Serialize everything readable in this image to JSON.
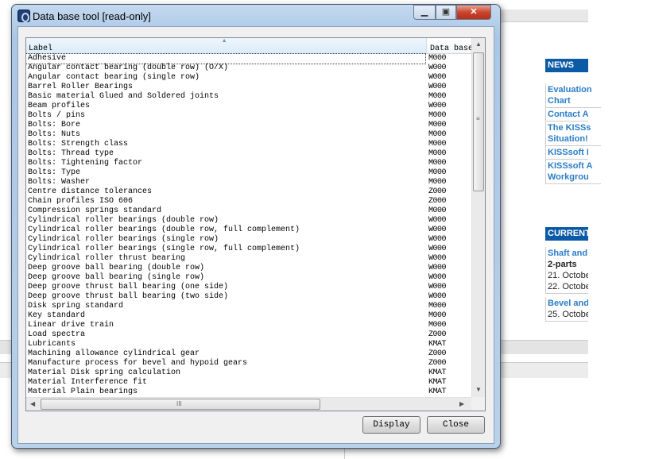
{
  "dialog": {
    "title": "Data base tool [read-only]",
    "minimize_icon": "minimize-icon",
    "maximize_icon": "maximize-icon",
    "close_icon": "close-x-icon"
  },
  "table": {
    "columns": [
      "Label",
      "Data base"
    ],
    "sort_indicator": "ascending",
    "rows": [
      {
        "label": "Adhesive",
        "db": "M000"
      },
      {
        "label": "Angular contact bearing (double row) (O/X)",
        "db": "W000"
      },
      {
        "label": "Angular contact bearing (single row)",
        "db": "W000"
      },
      {
        "label": "Barrel Roller Bearings",
        "db": "W000"
      },
      {
        "label": "Basic material Glued and Soldered joints",
        "db": "M000"
      },
      {
        "label": "Beam profiles",
        "db": "W000"
      },
      {
        "label": "Bolts / pins",
        "db": "M000"
      },
      {
        "label": "Bolts: Bore",
        "db": "M000"
      },
      {
        "label": "Bolts: Nuts",
        "db": "M000"
      },
      {
        "label": "Bolts: Strength class",
        "db": "M000"
      },
      {
        "label": "Bolts: Thread type",
        "db": "M000"
      },
      {
        "label": "Bolts: Tightening factor",
        "db": "M000"
      },
      {
        "label": "Bolts: Type",
        "db": "M000"
      },
      {
        "label": "Bolts: Washer",
        "db": "M000"
      },
      {
        "label": "Centre distance tolerances",
        "db": "Z000"
      },
      {
        "label": "Chain profiles ISO 606",
        "db": "Z000"
      },
      {
        "label": "Compression springs standard",
        "db": "M000"
      },
      {
        "label": "Cylindrical roller bearings (double row)",
        "db": "W000"
      },
      {
        "label": "Cylindrical roller bearings (double row, full complement)",
        "db": "W000"
      },
      {
        "label": "Cylindrical roller bearings (single row)",
        "db": "W000"
      },
      {
        "label": "Cylindrical roller bearings (single row, full complement)",
        "db": "W000"
      },
      {
        "label": "Cylindrical roller thrust bearing",
        "db": "W000"
      },
      {
        "label": "Deep groove ball bearing (double row)",
        "db": "W000"
      },
      {
        "label": "Deep groove ball bearing (single row)",
        "db": "W000"
      },
      {
        "label": "Deep groove thrust ball bearing (one side)",
        "db": "W000"
      },
      {
        "label": "Deep groove thrust ball bearing (two side)",
        "db": "W000"
      },
      {
        "label": "Disk spring standard",
        "db": "M000"
      },
      {
        "label": "Key standard",
        "db": "M000"
      },
      {
        "label": "Linear drive train",
        "db": "M000"
      },
      {
        "label": "Load spectra",
        "db": "Z000"
      },
      {
        "label": "Lubricants",
        "db": "KMAT"
      },
      {
        "label": "Machining allowance cylindrical gear",
        "db": "Z000"
      },
      {
        "label": "Manufacture process for bevel and hypoid gears",
        "db": "Z000"
      },
      {
        "label": "Material Disk spring calculation",
        "db": "KMAT"
      },
      {
        "label": "Material Interference fit",
        "db": "KMAT"
      },
      {
        "label": "Material Plain bearings",
        "db": "KMAT"
      }
    ]
  },
  "buttons": {
    "display": "Display",
    "close": "Close"
  },
  "background_page": {
    "news_header": "NEWS",
    "news_items": [
      "Evaluation Chart",
      "Contact A",
      "The KISSs Situation!",
      "KISSsoft I",
      "KISSsoft A Workgrou"
    ],
    "current_header": "CURRENT",
    "current_items": [
      {
        "title": "Shaft and",
        "sub": "2-parts",
        "dates": [
          "21. Octobe",
          "22. Octobe"
        ]
      },
      {
        "title": "Bevel and",
        "dates": [
          "25. Octobe"
        ]
      }
    ],
    "accent": "#0b5aa6"
  }
}
